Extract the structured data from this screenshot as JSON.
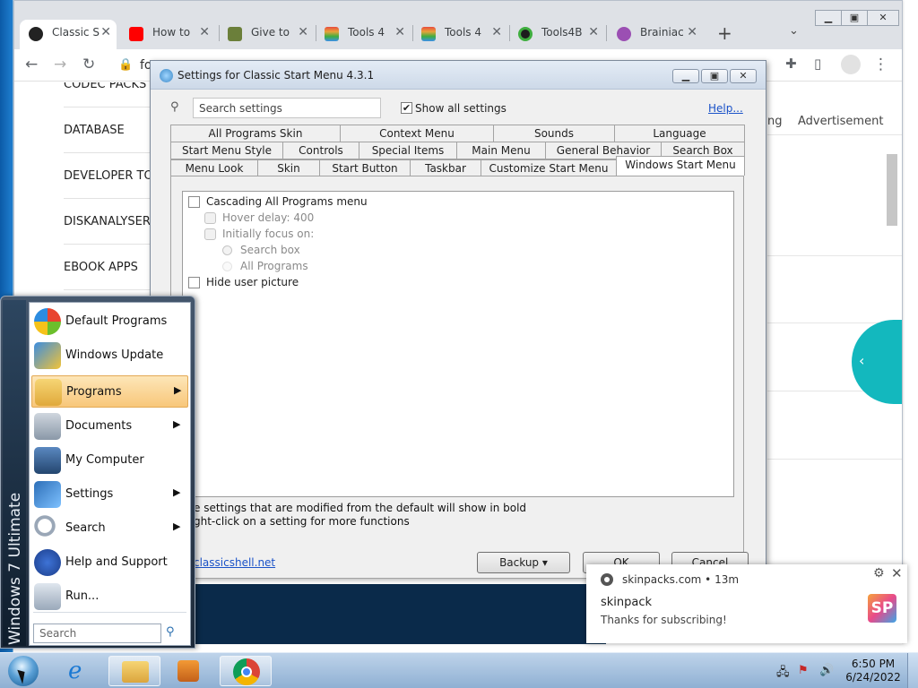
{
  "browser": {
    "tabs": [
      {
        "title": "Classic S",
        "favicon": "q-icon",
        "color": "#222222"
      },
      {
        "title": "How to",
        "favicon": "youtube-icon",
        "color": "#ff0000"
      },
      {
        "title": "Give to",
        "favicon": "giveaway-icon",
        "color": "#6b7f3a"
      },
      {
        "title": "Tools 4",
        "favicon": "rainbow-icon",
        "color": "#e9a23b"
      },
      {
        "title": "Tools 4",
        "favicon": "rainbow-icon",
        "color": "#e9a23b"
      },
      {
        "title": "Tools4B",
        "favicon": "gear-icon",
        "color": "#3fae3f"
      },
      {
        "title": "Brainiac",
        "favicon": "brain-icon",
        "color": "#9b4fb3"
      }
    ],
    "address_fragment": "fo"
  },
  "page": {
    "categories": [
      "CODEC PACKS",
      "DATABASE",
      "DEVELOPER TOO",
      "DISKANALYSERS",
      "EBOOK APPS"
    ],
    "right_label_partial": "ng",
    "advertisement": "Advertisement",
    "teal_arrow": "‹"
  },
  "dialog": {
    "title": "Settings for Classic Start Menu 4.3.1",
    "search_placeholder": "Search settings",
    "show_all_label": "Show all settings",
    "show_all_checked": "✔",
    "help": "Help...",
    "tabs_row1": [
      "All Programs Skin",
      "Context Menu",
      "Sounds",
      "Language"
    ],
    "tabs_row2": [
      "Start Menu Style",
      "Controls",
      "Special Items",
      "Main Menu",
      "General Behavior",
      "Search Box"
    ],
    "tabs_row3": [
      "Menu Look",
      "Skin",
      "Start Button",
      "Taskbar",
      "Customize Start Menu",
      "Windows Start Menu"
    ],
    "options": {
      "cascading": "Cascading All Programs menu",
      "hover_delay": "Hover delay: 400",
      "initial_focus": "Initially focus on:",
      "search_box": "Search box",
      "all_programs": "All Programs",
      "hide_user_picture": "Hide user picture"
    },
    "note1": "e settings that are modified from the default will show in bold",
    "note2": "ght-click on a setting for more functions",
    "link": "classicshell.net",
    "backup": "Backup",
    "ok": "OK",
    "cancel": "Cancel"
  },
  "notification": {
    "source": "skinpacks.com",
    "age": "13m",
    "title": "skinpack",
    "message": "Thanks for subscribing!",
    "logo_text": "SP"
  },
  "start_menu": {
    "band_label": "Windows 7 Ultimate",
    "items": [
      {
        "label": "Default Programs",
        "submenu": false
      },
      {
        "label": "Windows Update",
        "submenu": false
      },
      {
        "label": "Programs",
        "submenu": true
      },
      {
        "label": "Documents",
        "submenu": true
      },
      {
        "label": "My Computer",
        "submenu": false
      },
      {
        "label": "Settings",
        "submenu": true
      },
      {
        "label": "Search",
        "submenu": true
      },
      {
        "label": "Help and Support",
        "submenu": false
      },
      {
        "label": "Run...",
        "submenu": false
      }
    ],
    "search_placeholder": "Search"
  },
  "taskbar": {
    "time": "6:50 PM",
    "date": "6/24/2022"
  }
}
